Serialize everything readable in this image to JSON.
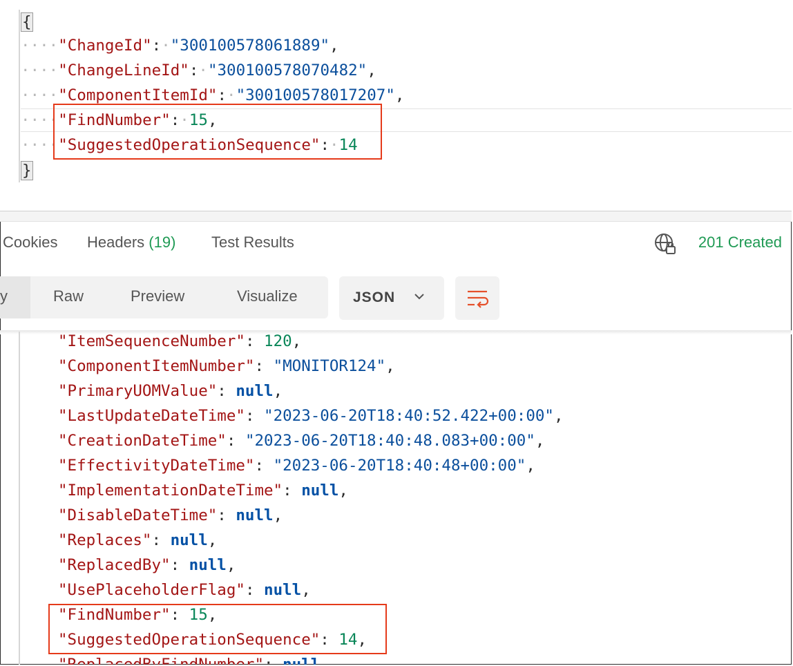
{
  "request_body": {
    "open_brace": "{",
    "close_brace": "}",
    "lines": [
      {
        "key": "\"ChangeId\"",
        "value": "\"300100578061889\"",
        "type": "str",
        "trail": ","
      },
      {
        "key": "\"ChangeLineId\"",
        "value": "\"300100578070482\"",
        "type": "str",
        "trail": ","
      },
      {
        "key": "\"ComponentItemId\"",
        "value": "\"300100578017207\"",
        "type": "str",
        "trail": ","
      },
      {
        "key": "\"FindNumber\"",
        "value": "15",
        "type": "num",
        "trail": ","
      },
      {
        "key": "\"SuggestedOperationSequence\"",
        "value": "14",
        "type": "num",
        "trail": ""
      }
    ]
  },
  "response_tabs": {
    "cookies": "Cookies",
    "headers": "Headers",
    "headers_count": "(19)",
    "test_results": "Test Results",
    "status": "201 Created"
  },
  "toolbar": {
    "pretty_partial": "y",
    "raw": "Raw",
    "preview": "Preview",
    "visualize": "Visualize",
    "format": "JSON"
  },
  "response_body": {
    "lines": [
      {
        "key": "\"ItemSequenceNumber\"",
        "value": "120",
        "type": "num",
        "trail": ","
      },
      {
        "key": "\"ComponentItemNumber\"",
        "value": "\"MONITOR124\"",
        "type": "str",
        "trail": ","
      },
      {
        "key": "\"PrimaryUOMValue\"",
        "value": "null",
        "type": "kw",
        "trail": ","
      },
      {
        "key": "\"LastUpdateDateTime\"",
        "value": "\"2023-06-20T18:40:52.422+00:00\"",
        "type": "str",
        "trail": ","
      },
      {
        "key": "\"CreationDateTime\"",
        "value": "\"2023-06-20T18:40:48.083+00:00\"",
        "type": "str",
        "trail": ","
      },
      {
        "key": "\"EffectivityDateTime\"",
        "value": "\"2023-06-20T18:40:48+00:00\"",
        "type": "str",
        "trail": ","
      },
      {
        "key": "\"ImplementationDateTime\"",
        "value": "null",
        "type": "kw",
        "trail": ","
      },
      {
        "key": "\"DisableDateTime\"",
        "value": "null",
        "type": "kw",
        "trail": ","
      },
      {
        "key": "\"Replaces\"",
        "value": "null",
        "type": "kw",
        "trail": ","
      },
      {
        "key": "\"ReplacedBy\"",
        "value": "null",
        "type": "kw",
        "trail": ","
      },
      {
        "key": "\"UsePlaceholderFlag\"",
        "value": "null",
        "type": "kw",
        "trail": ","
      },
      {
        "key": "\"FindNumber\"",
        "value": "15",
        "type": "num",
        "trail": ","
      },
      {
        "key": "\"SuggestedOperationSequence\"",
        "value": "14",
        "type": "num",
        "trail": ","
      },
      {
        "key": "\"ReplacedByFindNumber\"",
        "value": "null",
        "type": "kw",
        "trail": ","
      }
    ]
  },
  "colors": {
    "key": "#a31515",
    "string": "#0b4f9c",
    "number": "#098658",
    "keyword": "#0451a5",
    "status_ok": "#1f9a54",
    "highlight_box": "#e53a1a"
  },
  "icons": [
    "globe-lock-icon",
    "chevron-down-icon",
    "wrap-lines-icon"
  ]
}
